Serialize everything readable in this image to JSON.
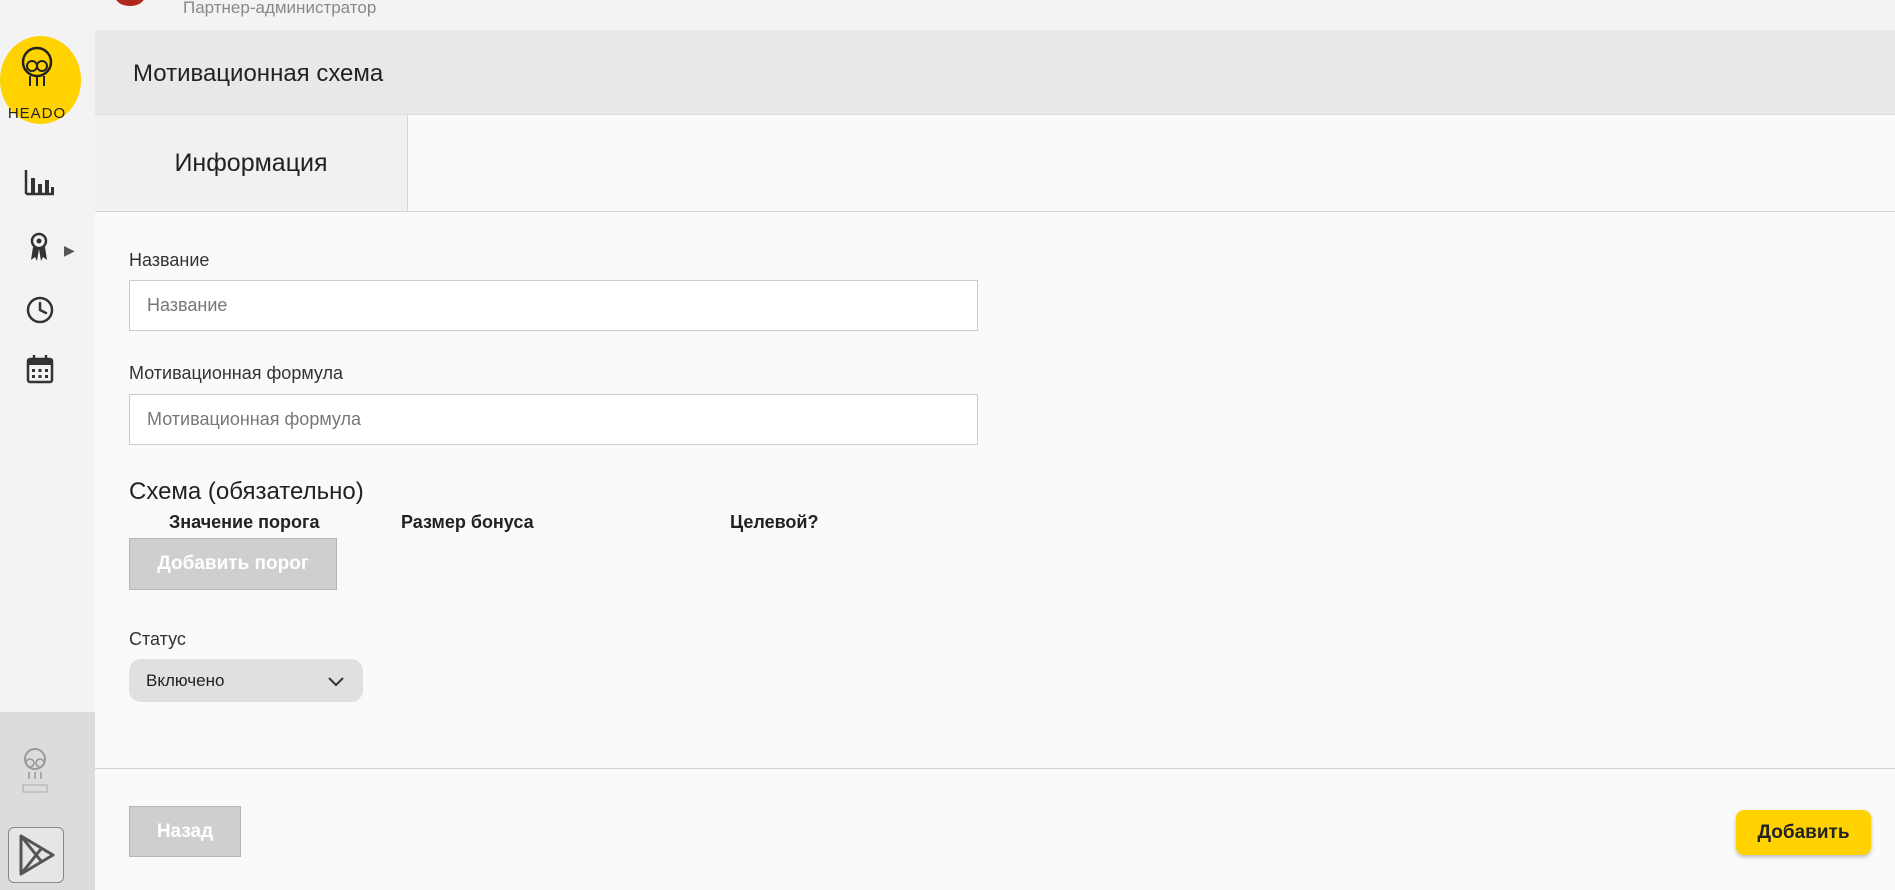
{
  "top": {
    "role": "Партнер-администратор"
  },
  "brand": {
    "logo_text": "HEADO",
    "accent": "#ffd200"
  },
  "sidebar": {
    "items": [
      {
        "name": "analytics",
        "icon": "bar-chart-icon"
      },
      {
        "name": "awards",
        "icon": "award-icon",
        "has_submenu": true
      },
      {
        "name": "history",
        "icon": "clock-icon"
      },
      {
        "name": "calendar",
        "icon": "calendar-icon"
      }
    ],
    "submenu_arrow": "▶"
  },
  "header": {
    "title": "Мотивационная схема"
  },
  "tabs": [
    {
      "label": "Информация",
      "active": true
    }
  ],
  "form": {
    "name": {
      "label": "Название",
      "placeholder": "Название",
      "value": ""
    },
    "formula": {
      "label": "Мотивационная формула",
      "placeholder": "Мотивационная формула",
      "value": ""
    },
    "scheme": {
      "title": "Схема (обязательно)",
      "columns": [
        "Значение порога",
        "Размер бонуса",
        "Целевой?"
      ],
      "add_button": "Добавить порог"
    },
    "status": {
      "label": "Статус",
      "value": "Включено"
    }
  },
  "footer": {
    "back_button": "Назад",
    "add_button": "Добавить"
  }
}
